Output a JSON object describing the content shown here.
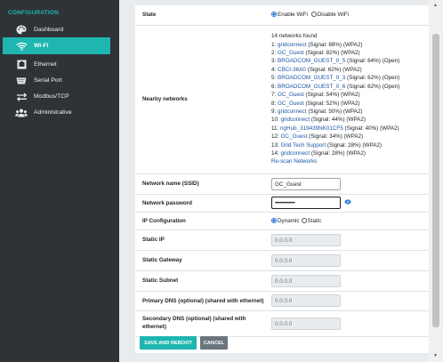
{
  "sidebar": {
    "title": "CONFIGURATION",
    "items": [
      {
        "label": "Dashboard",
        "icon": "palette-icon"
      },
      {
        "label": "Wi-Fi",
        "icon": "wifi-icon",
        "active": true
      },
      {
        "label": "Ethernet",
        "icon": "ethernet-port-icon"
      },
      {
        "label": "Serial Port",
        "icon": "serial-port-icon"
      },
      {
        "label": "Modbus/TCP",
        "icon": "transfer-arrows-icon"
      },
      {
        "label": "Administrative",
        "icon": "users-icon"
      }
    ]
  },
  "form": {
    "state": {
      "label": "State",
      "options": [
        "Enable WiFi",
        "Disable WiFi"
      ],
      "selected": "Enable WiFi"
    },
    "nearby": {
      "label": "Nearby networks",
      "found_text": "14 networks found",
      "networks": [
        {
          "prefix": "1: ",
          "ssid": "gridconnect",
          "details": " (Signal: 88%) (WPA2)"
        },
        {
          "prefix": "2: ",
          "ssid": "GC_Guest",
          "details": " (Signal: 82%) (WPA2)"
        },
        {
          "prefix": "3: ",
          "ssid": "BROADCOM_GUEST_0_5",
          "details": " (Signal: 64%) (Open)"
        },
        {
          "prefix": "4: ",
          "ssid": "CBCI-36A0",
          "details": " (Signal: 62%) (WPA2)"
        },
        {
          "prefix": "5: ",
          "ssid": "BROADCOM_GUEST_0_3",
          "details": " (Signal: 62%) (Open)"
        },
        {
          "prefix": "6: ",
          "ssid": "BROADCOM_GUEST_0_6",
          "details": " (Signal: 62%) (Open)"
        },
        {
          "prefix": "7: ",
          "ssid": "GC_Guest",
          "details": " (Signal: 54%) (WPA2)"
        },
        {
          "prefix": "8: ",
          "ssid": "GC_Guest",
          "details": " (Signal: 52%) (WPA2)"
        },
        {
          "prefix": "9: ",
          "ssid": "gridconnect",
          "details": " (Signal: 50%) (WPA2)"
        },
        {
          "prefix": "10: ",
          "ssid": "gridconnect",
          "details": " (Signal: 44%) (WPA2)"
        },
        {
          "prefix": "11: ",
          "ssid": "ngHub_319439NK01CF5",
          "details": " (Signal: 40%) (WPA2)"
        },
        {
          "prefix": "12: ",
          "ssid": "GC_Guest",
          "details": " (Signal: 34%) (WPA2)"
        },
        {
          "prefix": "13: ",
          "ssid": "Grid Tech Support",
          "details": " (Signal: 28%) (WPA2)"
        },
        {
          "prefix": "14: ",
          "ssid": "gridconnect",
          "details": " (Signal: 28%) (WPA2)"
        }
      ],
      "rescan": "Re-scan Networks"
    },
    "ssid": {
      "label": "Network name (SSID)",
      "value": "GC_Guest"
    },
    "password": {
      "label": "Network password",
      "value": "•••••••••••••"
    },
    "ip_config": {
      "label": "IP Configuration",
      "options": [
        "Dynamic",
        "Static"
      ],
      "selected": "Dynamic"
    },
    "static_ip": {
      "label": "Static IP",
      "value": "0.0.0.0"
    },
    "static_gateway": {
      "label": "Static Gateway",
      "value": "0.0.0.0"
    },
    "static_subnet": {
      "label": "Static Subnet",
      "value": "0.0.0.0"
    },
    "primary_dns": {
      "label": "Primary DNS (optional) (shared with ethernet)",
      "value": "0.0.0.0"
    },
    "secondary_dns": {
      "label": "Secondary DNS (optional) (shared with ethernet)",
      "value": "0.0.0.0"
    },
    "buttons": {
      "save": "SAVE AND REBOOT",
      "cancel": "CANCEL"
    }
  },
  "colors": {
    "accent": "#1fb6b1",
    "sidebar_bg": "#2f3338",
    "link": "#1a57a7"
  }
}
